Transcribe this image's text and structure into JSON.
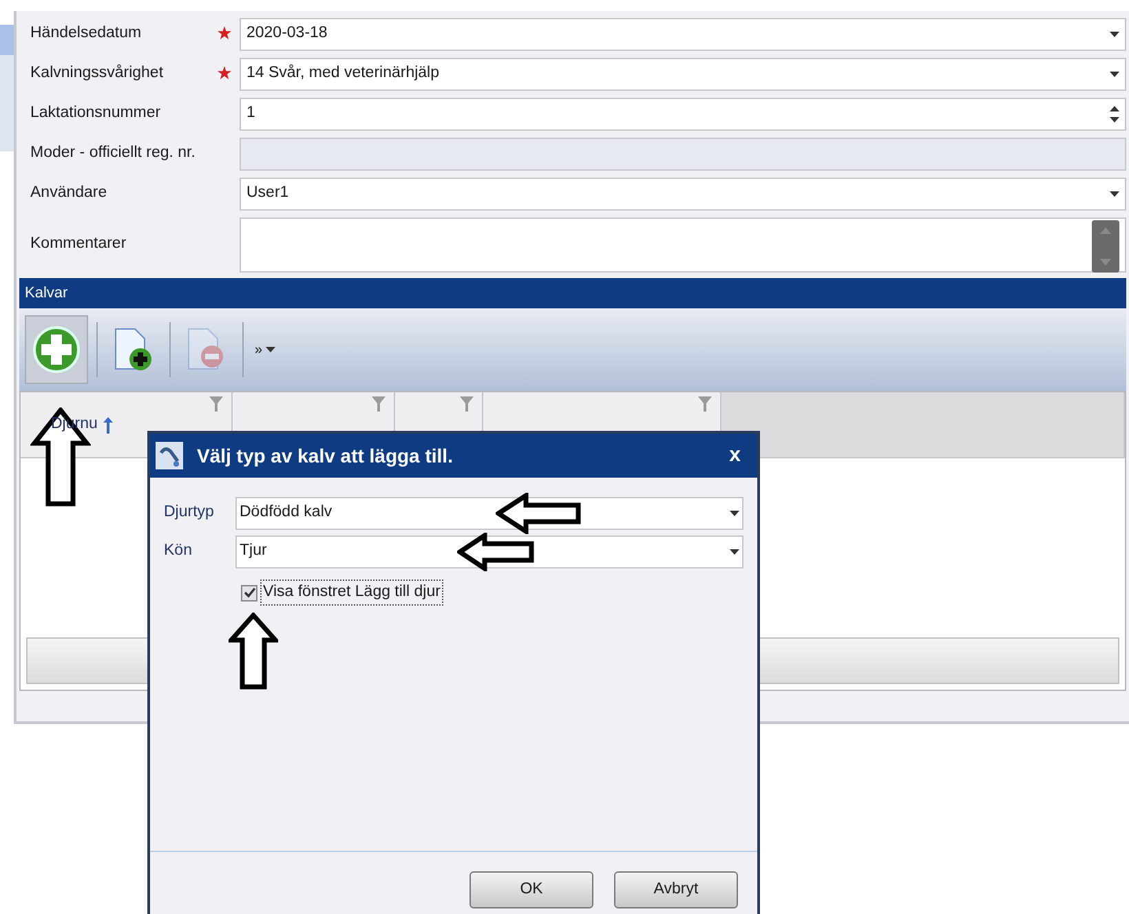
{
  "form": {
    "fields": [
      {
        "label": "Händelsedatum",
        "required": true,
        "value": "2020-03-18",
        "kind": "dropdown"
      },
      {
        "label": "Kalvningssvårighet",
        "required": true,
        "value": "14 Svår, med veterinärhjälp",
        "kind": "dropdown"
      },
      {
        "label": "Laktationsnummer",
        "required": false,
        "value": "1",
        "kind": "spinner"
      },
      {
        "label": "Moder - officiellt reg. nr.",
        "required": false,
        "kind": "readonly"
      },
      {
        "label": "Användare",
        "required": false,
        "value": "User1",
        "kind": "dropdown"
      },
      {
        "label": "Kommentarer",
        "required": false,
        "kind": "memo"
      }
    ]
  },
  "calves_panel": {
    "title": "Kalvar",
    "toolbar": [
      {
        "kind": "add",
        "disabled": false,
        "selected": true
      },
      {
        "kind": "add-document",
        "disabled": false,
        "selected": false
      },
      {
        "kind": "remove",
        "disabled": true,
        "selected": false
      },
      {
        "kind": "overflow",
        "label": "»",
        "disabled": false,
        "selected": false
      }
    ],
    "grid": {
      "columns": [
        {
          "header": "Djurnu",
          "sorted": true,
          "filter": true
        },
        {
          "sorted": false,
          "filter": true
        },
        {
          "sorted": false,
          "filter": true
        },
        {
          "sorted": false,
          "filter": true
        },
        {
          "sorted": false,
          "filter": false
        }
      ]
    }
  },
  "dialog": {
    "title": "Välj typ av kalv att lägga till.",
    "close": "x",
    "fields": [
      {
        "label": "Djurtyp",
        "value": "Dödfödd kalv"
      },
      {
        "label": "Kön",
        "value": "Tjur"
      }
    ],
    "checkbox": {
      "label": "Visa fönstret Lägg till djur",
      "checked": true
    },
    "buttons": [
      "OK",
      "Avbryt"
    ]
  }
}
